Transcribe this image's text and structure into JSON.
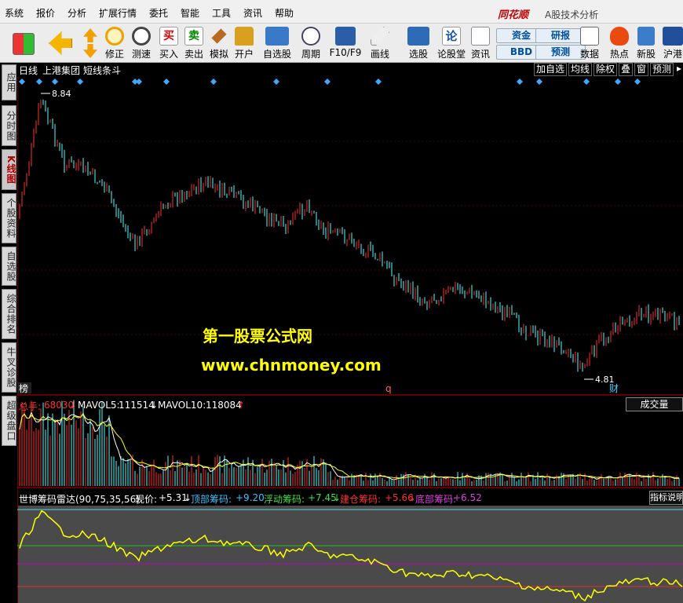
{
  "menu": [
    "系统",
    "报价",
    "分析",
    "扩展行情",
    "委托",
    "智能",
    "工具",
    "资讯",
    "帮助"
  ],
  "app": {
    "logo": "同花顺",
    "title": "A股技术分析"
  },
  "toolbar": [
    "修正",
    "测速",
    "买入",
    "卖出",
    "模拟",
    "开户",
    "自选股",
    "周期",
    "F10/F9",
    "画线",
    "选股",
    "论股堂",
    "资讯",
    "数据",
    "热点",
    "新股",
    "沪港"
  ],
  "quick_buttons": [
    "资金",
    "研报",
    "BBD",
    "预测"
  ],
  "icon_glyphs": {
    "buy": "买",
    "sell": "卖",
    "lun": "论"
  },
  "side_tabs": [
    "应用",
    "分时图",
    "K线图",
    "个股资料",
    "自选股",
    "综合排名",
    "牛叉诊股",
    "超级盘口"
  ],
  "panel": {
    "period": "日线",
    "stock": "上港集团",
    "title": "短线条斗",
    "right_buttons": [
      "加自选",
      "均线",
      "除权",
      "叠",
      "窗",
      "预测"
    ]
  },
  "price_labels": {
    "high": "8.84",
    "low": "4.81"
  },
  "markers": {
    "bang": "榜",
    "q": "q",
    "cai": "财"
  },
  "volume": {
    "total_label": "总手:",
    "total": "68030",
    "ma5_label": "MAVOL5:",
    "ma5": "111514",
    "ma10_label": "MAVOL10:",
    "ma10": "118084",
    "button": "成交量"
  },
  "indicator": {
    "name": "世博筹码雷达(90,75,35,56)",
    "cur_label": "现价:",
    "cur": "+5.31",
    "top_label": "顶部筹码:",
    "top": "+9.20",
    "float_label": "浮动筹码:",
    "float": "+7.45",
    "build_label": "建仓筹码:",
    "build": "+5.66",
    "bottom_label": "底部筹码:",
    "bottom": "+6.52",
    "button": "指标说明"
  },
  "watermark": {
    "line1": "第一股票公式网",
    "line2": "www.chnmoney.com"
  },
  "colors": {
    "up": "#ff3030",
    "down": "#54ffff",
    "ma5": "#ffffff",
    "ma10": "#ffff00",
    "zero": "#c000c0",
    "bg": "#000000"
  }
}
